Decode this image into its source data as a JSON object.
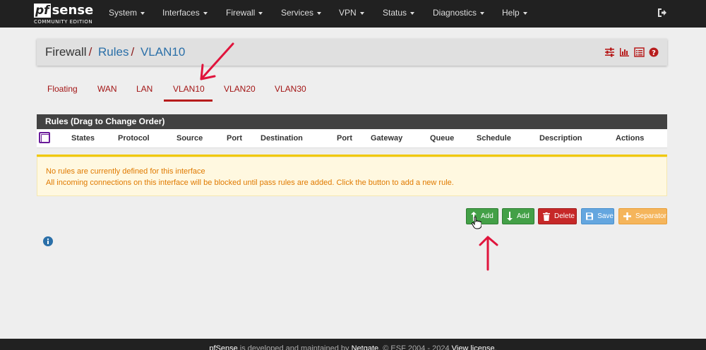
{
  "brand": {
    "logo_main": "pf",
    "logo_sense": "sense",
    "subtitle": "COMMUNITY EDITION"
  },
  "nav": {
    "items": [
      "System",
      "Interfaces",
      "Firewall",
      "Services",
      "VPN",
      "Status",
      "Diagnostics",
      "Help"
    ],
    "logout_icon": "sign-out-icon"
  },
  "breadcrumb": {
    "root": "Firewall",
    "rules": "Rules",
    "current": "VLAN10",
    "sep": "/"
  },
  "tabs": {
    "items": [
      "Floating",
      "WAN",
      "LAN",
      "VLAN10",
      "VLAN20",
      "VLAN30"
    ],
    "active": "VLAN10"
  },
  "rules": {
    "title": "Rules (Drag to Change Order)",
    "columns": [
      "States",
      "Protocol",
      "Source",
      "Port",
      "Destination",
      "Port",
      "Gateway",
      "Queue",
      "Schedule",
      "Description",
      "Actions"
    ],
    "empty_line1": "No rules are currently defined for this interface",
    "empty_line2": "All incoming connections on this interface will be blocked until pass rules are added. Click the button to add a new rule."
  },
  "buttons": {
    "add_top": "Add",
    "add_bottom": "Add",
    "delete": "Delete",
    "save": "Save",
    "separator": "Separator"
  },
  "footer": {
    "brand": "pfSense",
    "text1": " is developed and maintained by ",
    "company": "Netgate",
    "text2": ". © ESF 2004 - 2024 ",
    "license": "View license."
  },
  "colors": {
    "navbar": "#212121",
    "accent_red": "#b71c1c",
    "link_blue": "#2a6fa8",
    "warning_text": "#e07a00",
    "annotation": "#e0143c"
  }
}
